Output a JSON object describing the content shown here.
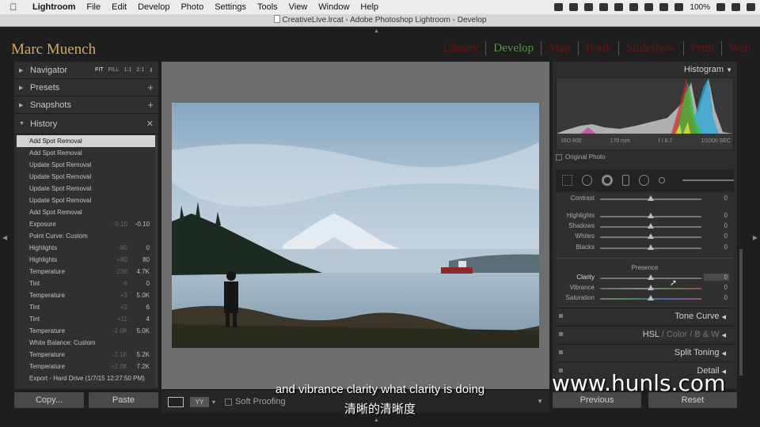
{
  "menubar": {
    "app": "Lightroom",
    "items": [
      "File",
      "Edit",
      "Develop",
      "Photo",
      "Settings",
      "Tools",
      "View",
      "Window",
      "Help"
    ],
    "battery": "100%"
  },
  "window_title": "CreativeLive.lrcat - Adobe Photoshop Lightroom - Develop",
  "identity_plate": "Marc Muench",
  "modules": [
    "Library",
    "Develop",
    "Map",
    "Book",
    "Slideshow",
    "Print",
    "Web"
  ],
  "active_module": "Develop",
  "left_panel": {
    "navigator": {
      "label": "Navigator",
      "zoom": [
        "FIT",
        "FILL",
        "1:1",
        "2:1"
      ]
    },
    "presets": "Presets",
    "snapshots": "Snapshots",
    "history_label": "History",
    "history": [
      {
        "name": "Add Spot Removal",
        "selected": true
      },
      {
        "name": "Add Spot Removal"
      },
      {
        "name": "Update Spot Removal"
      },
      {
        "name": "Update Spot Removal"
      },
      {
        "name": "Update Spot Removal"
      },
      {
        "name": "Update Spot Removal"
      },
      {
        "name": "Add Spot Removal"
      },
      {
        "name": "Exposure",
        "delta": "-0.10",
        "value": "-0.10"
      },
      {
        "name": "Point Curve: Custom"
      },
      {
        "name": "Highlights",
        "delta": "-80",
        "value": "0"
      },
      {
        "name": "Highlights",
        "delta": "+80",
        "value": "80"
      },
      {
        "name": "Temperature",
        "delta": "-236",
        "value": "4.7K"
      },
      {
        "name": "Tint",
        "delta": "-6",
        "value": "0"
      },
      {
        "name": "Temperature",
        "delta": "+3",
        "value": "5.0K"
      },
      {
        "name": "Tint",
        "delta": "+2",
        "value": "6"
      },
      {
        "name": "Tint",
        "delta": "+11",
        "value": "4"
      },
      {
        "name": "Temperature",
        "delta": "-2.0K",
        "value": "5.0K"
      },
      {
        "name": "White Balance: Custom"
      },
      {
        "name": "Temperature",
        "delta": "-2.1K",
        "value": "5.2K"
      },
      {
        "name": "Temperature",
        "delta": "+2.0K",
        "value": "7.2K"
      },
      {
        "name": "Export - Hard Drive (1/7/15 12:27:50 PM)"
      }
    ],
    "copy_button": "Copy...",
    "paste_button": "Paste"
  },
  "toolbar": {
    "soft_proofing": "Soft Proofing",
    "view_mode": "YY"
  },
  "right_panel": {
    "histogram_label": "Histogram",
    "iso": "ISO 800",
    "focal_length": "170 mm",
    "aperture": "f / 6.7",
    "shutter": "1/1000 SEC",
    "original_photo": "Original Photo",
    "sliders": [
      {
        "label": "Contrast",
        "value": "0",
        "pos": 0.5
      },
      {
        "label": "Highlights",
        "value": "0",
        "pos": 0.5
      },
      {
        "label": "Shadows",
        "value": "0",
        "pos": 0.5
      },
      {
        "label": "Whites",
        "value": "0",
        "pos": 0.5
      },
      {
        "label": "Blacks",
        "value": "0",
        "pos": 0.5
      }
    ],
    "presence_label": "Presence",
    "presence_sliders": [
      {
        "label": "Clarity",
        "value": "0",
        "pos": 0.5,
        "active": true
      },
      {
        "label": "Vibrance",
        "value": "0",
        "pos": 0.5
      },
      {
        "label": "Saturation",
        "value": "0",
        "pos": 0.5
      }
    ],
    "panels": {
      "tone_curve": "Tone Curve",
      "hsl": "HSL",
      "color": "Color",
      "bw": "B & W",
      "split_toning": "Split Toning",
      "detail": "Detail"
    },
    "previous_button": "Previous",
    "reset_button": "Reset"
  },
  "subtitle_en": "and vibrance clarity what clarity is doing",
  "subtitle_zh": "清晰的清晰度",
  "watermark": "www.hunls.com"
}
